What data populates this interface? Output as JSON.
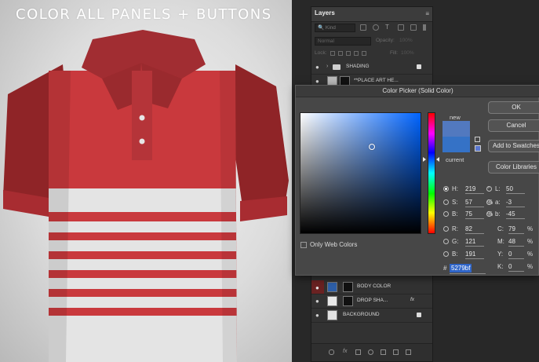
{
  "headline": "COLOR ALL PANELS + BUTTONS",
  "colors": {
    "shirt_red": "#c9393d",
    "shirt_red_dark": "#8f2427",
    "stripe_white": "#e4e4e4",
    "new_color": "#5279bf",
    "current_color": "#3572c6",
    "hex_highlight": "#2f65c8"
  },
  "layers_panel": {
    "tab": "Layers",
    "filter_kind": "Kind",
    "blend_mode": "Normal",
    "opacity_label": "Opacity:",
    "opacity_value": "100%",
    "lock_label": "Lock:",
    "fill_label": "Fill:",
    "fill_value": "100%",
    "layers": [
      {
        "name": "SHADING"
      },
      {
        "name": "**PLACE ART HE..."
      },
      {
        "name": "BODY COLOR"
      },
      {
        "name": "DROP SHA..."
      },
      {
        "name": "BACKGROUND"
      }
    ],
    "fx_label": "fx"
  },
  "color_picker": {
    "title": "Color Picker (Solid Color)",
    "new_label": "new",
    "current_label": "current",
    "buttons": {
      "ok": "OK",
      "cancel": "Cancel",
      "add_swatches": "Add to Swatches",
      "color_libraries": "Color Libraries"
    },
    "fields": {
      "H": {
        "label": "H:",
        "value": "219",
        "unit": "°"
      },
      "S": {
        "label": "S:",
        "value": "57",
        "unit": "%"
      },
      "B": {
        "label": "B:",
        "value": "75",
        "unit": "%"
      },
      "R": {
        "label": "R:",
        "value": "82"
      },
      "G": {
        "label": "G:",
        "value": "121"
      },
      "Bl": {
        "label": "B:",
        "value": "191"
      },
      "L": {
        "label": "L:",
        "value": "50"
      },
      "a": {
        "label": "a:",
        "value": "-3"
      },
      "b": {
        "label": "b:",
        "value": "-45"
      },
      "C": {
        "label": "C:",
        "value": "79",
        "unit": "%"
      },
      "M": {
        "label": "M:",
        "value": "48",
        "unit": "%"
      },
      "Y": {
        "label": "Y:",
        "value": "0",
        "unit": "%"
      },
      "K": {
        "label": "K:",
        "value": "0",
        "unit": "%"
      }
    },
    "hex_hash": "#",
    "hex": "5279bf",
    "only_web_colors": "Only Web Colors"
  }
}
